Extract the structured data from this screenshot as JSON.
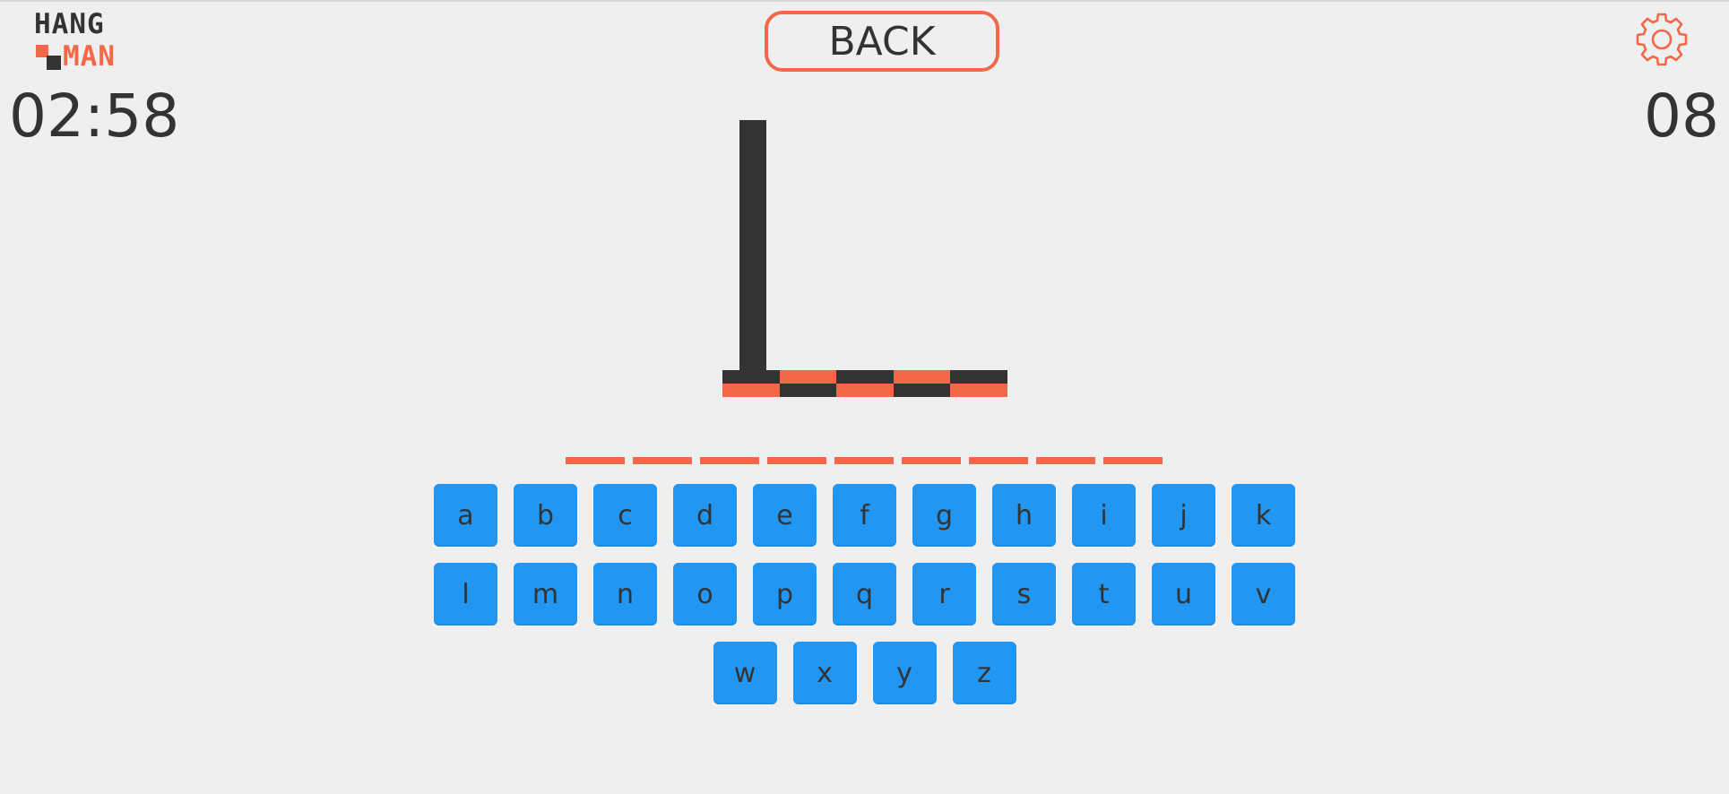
{
  "logo": {
    "line1": "HANG",
    "line2": "MAN"
  },
  "timer": "02:58",
  "score": "08",
  "back_button": {
    "label": "BACK"
  },
  "settings": {
    "icon": "gear-icon"
  },
  "word": {
    "slot_count": 9,
    "revealed": [
      "",
      "",
      "",
      "",
      "",
      "",
      "",
      "",
      ""
    ]
  },
  "keyboard": {
    "rows": [
      [
        "a",
        "b",
        "c",
        "d",
        "e",
        "f",
        "g",
        "h",
        "i",
        "j",
        "k"
      ],
      [
        "l",
        "m",
        "n",
        "o",
        "p",
        "q",
        "r",
        "s",
        "t",
        "u",
        "v"
      ],
      [
        "w",
        "x",
        "y",
        "z"
      ]
    ]
  },
  "colors": {
    "background": "#efefef",
    "accent": "#f26849",
    "dark": "#333333",
    "key": "#2196f3"
  }
}
